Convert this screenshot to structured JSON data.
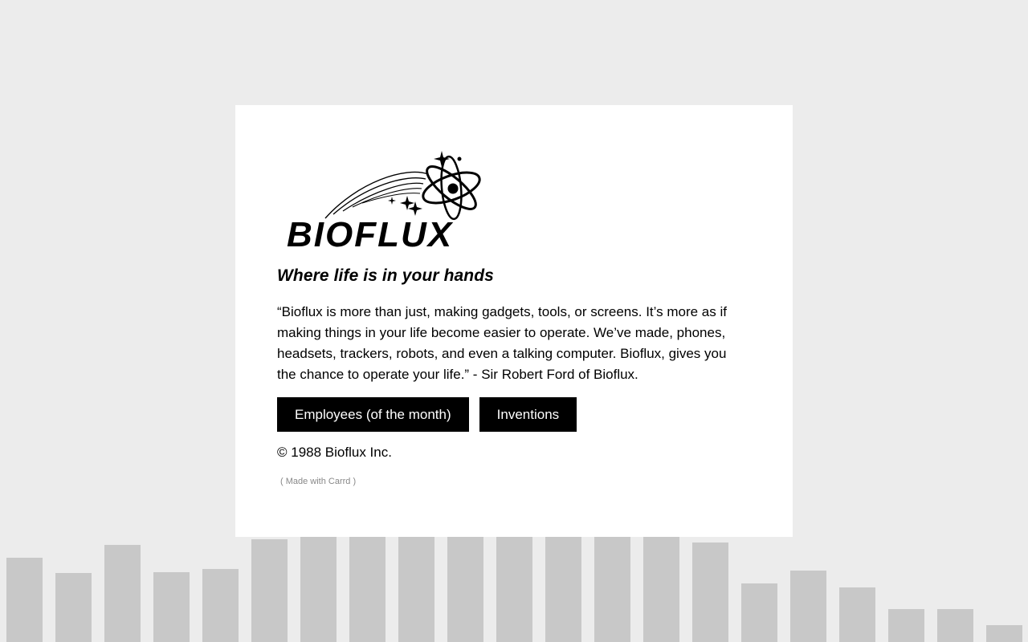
{
  "background": {
    "color": "#ececec",
    "bar_color": "#c8c8c8",
    "bar_levels": [
      0.131,
      0.108,
      0.151,
      0.109,
      0.114,
      0.16,
      0.196,
      0.196,
      0.196,
      0.196,
      0.196,
      0.196,
      0.196,
      0.196,
      0.155,
      0.091,
      0.111,
      0.085,
      0.051,
      0.051,
      0.026
    ]
  },
  "card": {
    "logo": {
      "text": "BIOFLUX",
      "icon": "atom-logo-icon"
    },
    "tagline": "Where life is in your hands",
    "quote": "“Bioflux is more than just, making gadgets, tools, or screens. It’s more as if making things in your life become easier to operate. We’ve made, phones, headsets, trackers, robots, and even a talking computer. Bioflux, gives you the chance to operate your life.” - Sir Robert Ford of Bioflux.",
    "buttons": [
      {
        "label": "Employees (of the month)"
      },
      {
        "label": "Inventions"
      }
    ],
    "copyright": "© 1988 Bioflux Inc.",
    "made_with": "( Made with Carrd )"
  }
}
